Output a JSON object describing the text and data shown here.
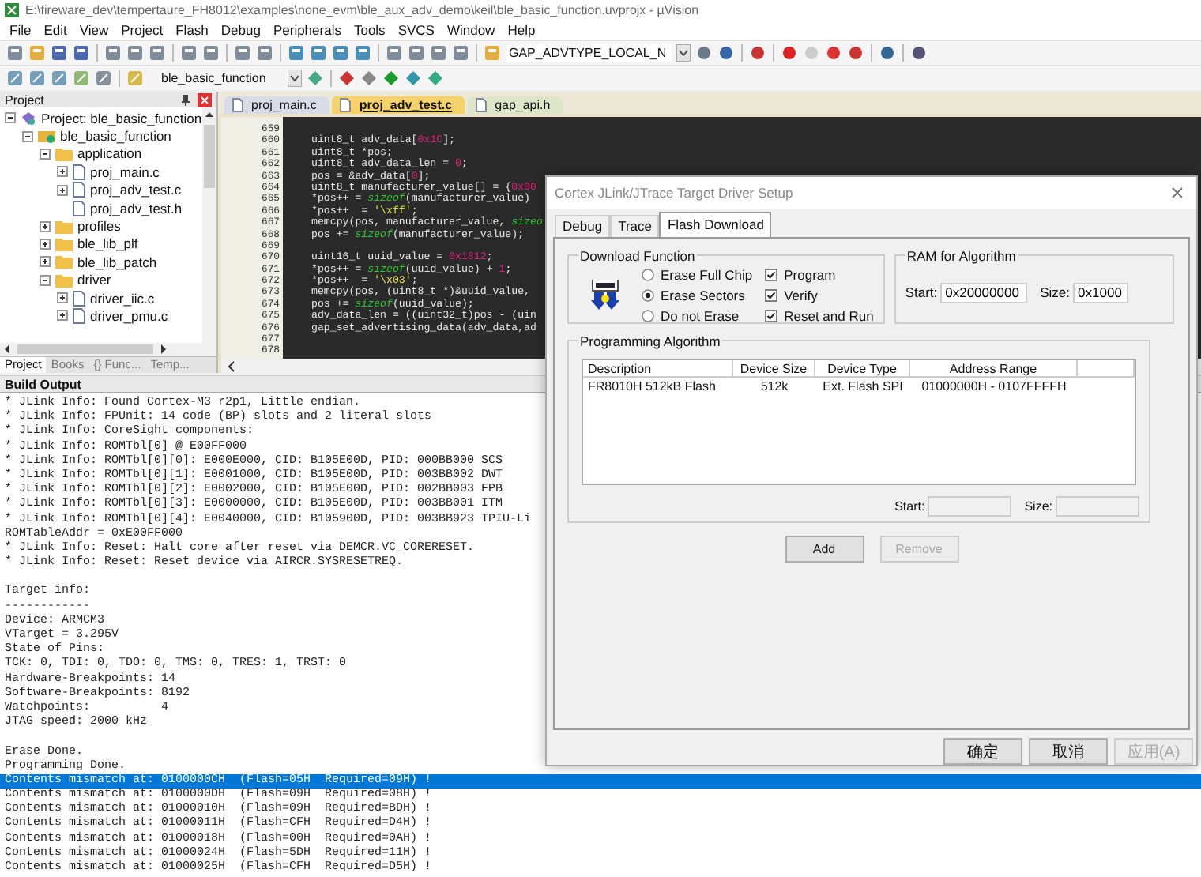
{
  "window": {
    "title": "E:\\fireware_dev\\tempertaure_FH8012\\examples\\none_evm\\ble_aux_adv_demo\\keil\\ble_basic_function.uvprojx - µVision"
  },
  "menu": [
    "File",
    "Edit",
    "View",
    "Project",
    "Flash",
    "Debug",
    "Peripherals",
    "Tools",
    "SVCS",
    "Window",
    "Help"
  ],
  "toolbar": {
    "find_combo": {
      "value": "GAP_ADVTYPE_LOCAL_N"
    },
    "target_combo": {
      "value": "ble_basic_function"
    }
  },
  "project_panel": {
    "title": "Project",
    "tree": [
      {
        "kind": "project",
        "label": "Project: ble_basic_function",
        "expanded": true,
        "children": [
          {
            "kind": "target",
            "label": "ble_basic_function",
            "expanded": true,
            "children": [
              {
                "kind": "folder",
                "label": "application",
                "expanded": true,
                "children": [
                  {
                    "kind": "file",
                    "label": "proj_main.c",
                    "expanded": false
                  },
                  {
                    "kind": "file",
                    "label": "proj_adv_test.c",
                    "expanded": false
                  },
                  {
                    "kind": "file",
                    "label": "proj_adv_test.h"
                  }
                ]
              },
              {
                "kind": "folder",
                "label": "profiles",
                "expanded": false
              },
              {
                "kind": "folder",
                "label": "ble_lib_plf",
                "expanded": false
              },
              {
                "kind": "folder",
                "label": "ble_lib_patch",
                "expanded": false
              },
              {
                "kind": "folder",
                "label": "driver",
                "expanded": true,
                "children": [
                  {
                    "kind": "file",
                    "label": "driver_iic.c",
                    "expanded": false
                  },
                  {
                    "kind": "file",
                    "label": "driver_pmu.c",
                    "expanded": false
                  }
                ]
              }
            ]
          }
        ]
      }
    ],
    "tabs": [
      {
        "label": "Project",
        "selected": true
      },
      {
        "label": "Books",
        "selected": false
      },
      {
        "label": "{} Func...",
        "selected": false
      },
      {
        "label": "Temp...",
        "selected": false
      }
    ]
  },
  "editor": {
    "tabs": [
      {
        "label": "proj_main.c",
        "selected": false
      },
      {
        "label": "proj_adv_test.c",
        "selected": true
      },
      {
        "label": "gap_api.h",
        "selected": false
      }
    ],
    "lines": [
      {
        "number": "659"
      },
      {
        "number": "660",
        "tokens": [
          {
            "kind": "plain",
            "text": "uint8_t adv_data["
          },
          {
            "kind": "number",
            "text": "0x1C"
          },
          {
            "kind": "plain",
            "text": "];"
          }
        ]
      },
      {
        "number": "661",
        "tokens": [
          {
            "kind": "plain",
            "text": "uint8_t *pos;"
          }
        ]
      },
      {
        "number": "662",
        "tokens": [
          {
            "kind": "plain",
            "text": "uint8_t adv_data_len = "
          },
          {
            "kind": "number",
            "text": "0"
          },
          {
            "kind": "plain",
            "text": ";"
          }
        ]
      },
      {
        "number": "663",
        "tokens": [
          {
            "kind": "plain",
            "text": "pos = &adv_data["
          },
          {
            "kind": "number",
            "text": "0"
          },
          {
            "kind": "plain",
            "text": "];"
          }
        ]
      },
      {
        "number": "664",
        "tokens": [
          {
            "kind": "plain",
            "text": "uint8_t manufacturer_value[] = {"
          },
          {
            "kind": "number",
            "text": "0x00"
          }
        ]
      },
      {
        "number": "665",
        "tokens": [
          {
            "kind": "plain",
            "text": "*pos++ = "
          },
          {
            "kind": "keyword",
            "text": "sizeof"
          },
          {
            "kind": "plain",
            "text": "(manufacturer_value)"
          }
        ]
      },
      {
        "number": "666",
        "tokens": [
          {
            "kind": "plain",
            "text": "*pos++  = "
          },
          {
            "kind": "string",
            "text": "'\\xff'"
          },
          {
            "kind": "plain",
            "text": ";"
          }
        ]
      },
      {
        "number": "667",
        "tokens": [
          {
            "kind": "plain",
            "text": "memcpy(pos, manufacturer_value, "
          },
          {
            "kind": "keyword",
            "text": "sizeo"
          }
        ]
      },
      {
        "number": "668",
        "tokens": [
          {
            "kind": "plain",
            "text": "pos += "
          },
          {
            "kind": "keyword",
            "text": "sizeof"
          },
          {
            "kind": "plain",
            "text": "(manufacturer_value);"
          }
        ]
      },
      {
        "number": "669"
      },
      {
        "number": "670",
        "tokens": [
          {
            "kind": "plain",
            "text": "uint16_t uuid_value = "
          },
          {
            "kind": "number",
            "text": "0x1812"
          },
          {
            "kind": "plain",
            "text": ";"
          }
        ]
      },
      {
        "number": "671",
        "tokens": [
          {
            "kind": "plain",
            "text": "*pos++ = "
          },
          {
            "kind": "keyword",
            "text": "sizeof"
          },
          {
            "kind": "plain",
            "text": "(uuid_value) + "
          },
          {
            "kind": "number",
            "text": "1"
          },
          {
            "kind": "plain",
            "text": ";"
          }
        ]
      },
      {
        "number": "672",
        "tokens": [
          {
            "kind": "plain",
            "text": "*pos++  = "
          },
          {
            "kind": "string",
            "text": "'\\x03'"
          },
          {
            "kind": "plain",
            "text": ";"
          }
        ]
      },
      {
        "number": "673",
        "tokens": [
          {
            "kind": "plain",
            "text": "memcpy(pos, (uint8_t *)&uuid_value,"
          }
        ]
      },
      {
        "number": "674",
        "tokens": [
          {
            "kind": "plain",
            "text": "pos += "
          },
          {
            "kind": "keyword",
            "text": "sizeof"
          },
          {
            "kind": "plain",
            "text": "(uuid_value);"
          }
        ]
      },
      {
        "number": "675",
        "tokens": [
          {
            "kind": "plain",
            "text": "adv_data_len = ((uint32_t)pos - (uin"
          }
        ]
      },
      {
        "number": "676",
        "tokens": [
          {
            "kind": "plain",
            "text": "gap_set_advertising_data(adv_data,ad"
          }
        ]
      },
      {
        "number": "677"
      },
      {
        "number": "678"
      }
    ]
  },
  "build_output": {
    "title": "Build Output",
    "lines": [
      {
        "text": "* JLink Info: Found Cortex-M3 r2p1, Little endian.",
        "selected": false
      },
      {
        "text": "* JLink Info: FPUnit: 14 code (BP) slots and 2 literal slots",
        "selected": false
      },
      {
        "text": "* JLink Info: CoreSight components:",
        "selected": false
      },
      {
        "text": "* JLink Info: ROMTbl[0] @ E00FF000",
        "selected": false
      },
      {
        "text": "* JLink Info: ROMTbl[0][0]: E000E000, CID: B105E00D, PID: 000BB000 SCS",
        "selected": false
      },
      {
        "text": "* JLink Info: ROMTbl[0][1]: E0001000, CID: B105E00D, PID: 003BB002 DWT",
        "selected": false
      },
      {
        "text": "* JLink Info: ROMTbl[0][2]: E0002000, CID: B105E00D, PID: 002BB003 FPB",
        "selected": false
      },
      {
        "text": "* JLink Info: ROMTbl[0][3]: E0000000, CID: B105E00D, PID: 003BB001 ITM",
        "selected": false
      },
      {
        "text": "* JLink Info: ROMTbl[0][4]: E0040000, CID: B105900D, PID: 003BB923 TPIU-Li",
        "selected": false
      },
      {
        "text": "ROMTableAddr = 0xE00FF000",
        "selected": false
      },
      {
        "text": "* JLink Info: Reset: Halt core after reset via DEMCR.VC_CORERESET.",
        "selected": false
      },
      {
        "text": "* JLink Info: Reset: Reset device via AIRCR.SYSRESETREQ.",
        "selected": false
      },
      {
        "selected": false
      },
      {
        "text": "Target info:",
        "selected": false
      },
      {
        "text": "------------",
        "selected": false
      },
      {
        "text": "Device: ARMCM3",
        "selected": false
      },
      {
        "text": "VTarget = 3.295V",
        "selected": false
      },
      {
        "text": "State of Pins:",
        "selected": false
      },
      {
        "text": "TCK: 0, TDI: 0, TDO: 0, TMS: 0, TRES: 1, TRST: 0",
        "selected": false
      },
      {
        "text": "Hardware-Breakpoints: 14",
        "selected": false
      },
      {
        "text": "Software-Breakpoints: 8192",
        "selected": false
      },
      {
        "text": "Watchpoints:          4",
        "selected": false
      },
      {
        "text": "JTAG speed: 2000 kHz",
        "selected": false
      },
      {
        "selected": false
      },
      {
        "text": "Erase Done.",
        "selected": false
      },
      {
        "text": "Programming Done.",
        "selected": false
      },
      {
        "text": "Contents mismatch at: 0100000CH  (Flash=05H  Required=09H) !",
        "selected": true
      },
      {
        "text": "Contents mismatch at: 0100000DH  (Flash=09H  Required=08H) !",
        "selected": false
      },
      {
        "text": "Contents mismatch at: 01000010H  (Flash=09H  Required=BDH) !",
        "selected": false
      },
      {
        "text": "Contents mismatch at: 01000011H  (Flash=CFH  Required=D4H) !",
        "selected": false
      },
      {
        "text": "Contents mismatch at: 01000018H  (Flash=00H  Required=0AH) !",
        "selected": false
      },
      {
        "text": "Contents mismatch at: 01000024H  (Flash=5DH  Required=11H) !",
        "selected": false
      },
      {
        "text": "Contents mismatch at: 01000025H  (Flash=CFH  Required=D5H) !",
        "selected": false
      }
    ]
  },
  "dialog": {
    "title": "Cortex JLink/JTrace Target Driver Setup",
    "tabs": [
      {
        "label": "Debug",
        "selected": false
      },
      {
        "label": "Trace",
        "selected": false
      },
      {
        "label": "Flash Download",
        "selected": true
      }
    ],
    "download_function": {
      "title": "Download Function",
      "erase_options": [
        {
          "label": "Erase Full Chip",
          "selected": false
        },
        {
          "label": "Erase Sectors",
          "selected": true
        },
        {
          "label": "Do not Erase",
          "selected": false
        }
      ],
      "options": [
        {
          "label": "Program",
          "checked": true
        },
        {
          "label": "Verify",
          "checked": true
        },
        {
          "label": "Reset and Run",
          "checked": true
        }
      ]
    },
    "ram": {
      "title": "RAM for Algorithm",
      "start_label": "Start:",
      "start": "0x20000000",
      "size_label": "Size:",
      "size": "0x1000"
    },
    "algorithm": {
      "title": "Programming Algorithm",
      "columns": [
        "Description",
        "Device Size",
        "Device Type",
        "Address Range"
      ],
      "rows": [
        [
          "FR8010H 512kB Flash",
          "512k",
          "Ext. Flash SPI",
          "01000000H - 0107FFFFH"
        ]
      ],
      "start_label": "Start:",
      "size_label": "Size:"
    },
    "buttons": [
      {
        "label": "Add",
        "disabled": false
      },
      {
        "label": "Remove",
        "disabled": true
      }
    ],
    "footer_buttons": [
      {
        "label": "确定",
        "disabled": false
      },
      {
        "label": "取消",
        "disabled": false
      },
      {
        "label": "应用(A)",
        "disabled": true
      }
    ]
  }
}
